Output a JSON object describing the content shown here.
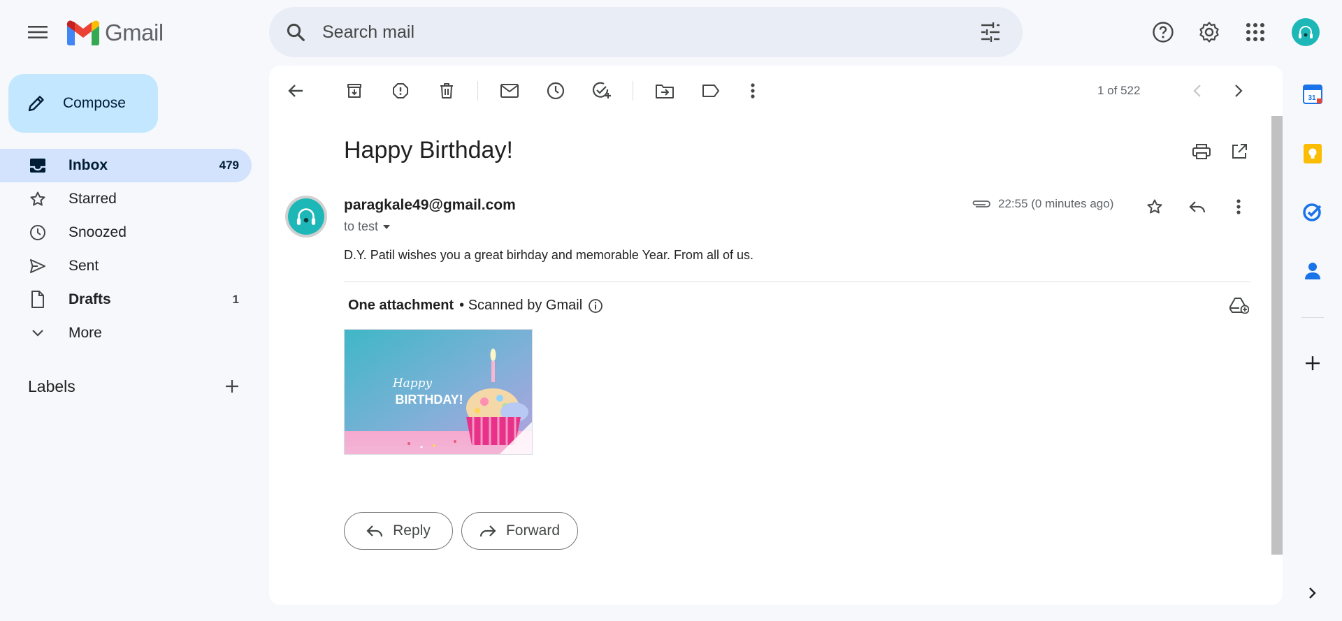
{
  "header": {
    "logo_text": "Gmail",
    "search_placeholder": "Search mail"
  },
  "compose": {
    "label": "Compose"
  },
  "nav": {
    "items": [
      {
        "label": "Inbox",
        "count": "479",
        "icon": "inbox-icon",
        "active": true
      },
      {
        "label": "Starred",
        "count": "",
        "icon": "star-icon"
      },
      {
        "label": "Snoozed",
        "count": "",
        "icon": "clock-icon"
      },
      {
        "label": "Sent",
        "count": "",
        "icon": "send-icon"
      },
      {
        "label": "Drafts",
        "count": "1",
        "icon": "draft-icon"
      },
      {
        "label": "More",
        "count": "",
        "icon": "chevron-down-icon"
      }
    ],
    "labels_title": "Labels"
  },
  "toolbar": {
    "pager": "1 of 522"
  },
  "email": {
    "subject": "Happy Birthday!",
    "sender": "paragkale49@gmail.com",
    "to": "to test",
    "time": "22:55 (0 minutes ago)",
    "body": "D.Y. Patil wishes you a great birhday and memorable Year. From all of us.",
    "attachment_title": "One attachment",
    "attachment_note": "• Scanned by Gmail",
    "thumb_text_1": "Happy",
    "thumb_text_2": "BIRTHDAY!"
  },
  "actions": {
    "reply_label": "Reply",
    "forward_label": "Forward"
  },
  "colors": {
    "accent": "#0b57d0",
    "compose_bg": "#c2e7ff",
    "active_nav_bg": "#d3e3fd",
    "avatar": "#1eb7b7"
  }
}
